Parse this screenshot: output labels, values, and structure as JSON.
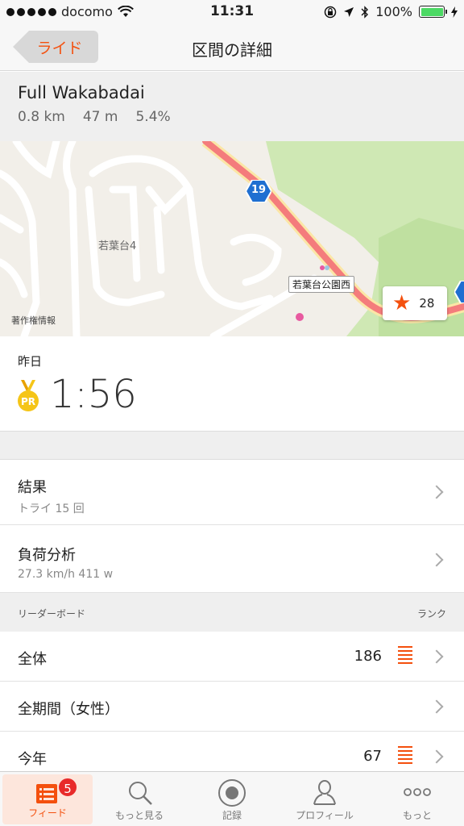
{
  "status_bar": {
    "carrier": "docomo",
    "time": "11:31",
    "battery": "100%"
  },
  "nav": {
    "back_label": "ライド",
    "title": "区間の詳細"
  },
  "segment": {
    "name": "Full Wakabadai",
    "distance": "0.8 km",
    "elevation": "47 m",
    "grade": "5.4%"
  },
  "map": {
    "attribution": "著作権情報",
    "place_label": "若葉台4",
    "poi_label": "若葉台公園西",
    "route_number": "19",
    "star_count": "28"
  },
  "effort": {
    "date": "昨日",
    "pr_badge": "PR",
    "time": "1:56"
  },
  "results": {
    "title": "結果",
    "subtitle": "トライ 15 回"
  },
  "analysis": {
    "title": "負荷分析",
    "subtitle": "27.3 km/h 411 w"
  },
  "leaderboard": {
    "header_left": "リーダーボード",
    "header_right": "ランク",
    "rows": [
      {
        "label": "全体",
        "value": "186"
      },
      {
        "label": "全期間（女性）",
        "value": ""
      },
      {
        "label": "今年",
        "value": "67"
      }
    ]
  },
  "tabs": [
    {
      "label": "フィード",
      "badge": "5",
      "icon": "feed-icon",
      "active": true
    },
    {
      "label": "もっと見る",
      "icon": "search-icon"
    },
    {
      "label": "記録",
      "icon": "record-icon"
    },
    {
      "label": "プロフィール",
      "icon": "profile-icon"
    },
    {
      "label": "もっと",
      "icon": "more-icon"
    }
  ],
  "colors": {
    "accent": "#f4500e",
    "route": "#f47c7c",
    "park": "#cfe8b4",
    "badge": "#e82a2a",
    "battery": "#4cd964",
    "medal": "#f5c518"
  }
}
